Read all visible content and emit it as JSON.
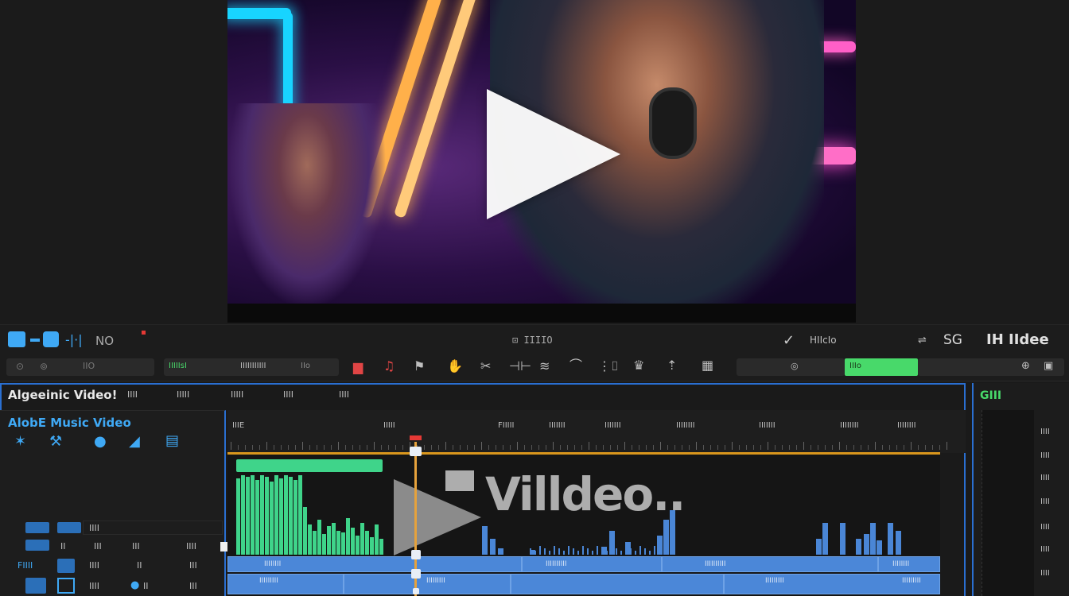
{
  "preview": {
    "play_icon": "play-icon",
    "colors": {
      "neon_cyan": "#1ed2ff",
      "neon_pink": "#ff4fd0",
      "neon_orange": "#ffb347"
    }
  },
  "toolbar_top": {
    "left_label": "NO",
    "center_label": "⊡ IIIIO",
    "right_codes": [
      "V",
      "HIIcIo",
      "SG",
      "IH IIdee"
    ]
  },
  "toolbar_second": {
    "left_items": [
      "⊙",
      "⊚",
      "IIO",
      "IIIIIsI",
      "IIIIIIIIIII",
      "IIo"
    ],
    "status_label": "IIIo"
  },
  "editor": {
    "title": "Algeeinic Video!",
    "tabs": [
      "IIII",
      "IIIII",
      "IIIII",
      "IIII",
      "IIII"
    ],
    "project_name": "AlobE Music Video",
    "left_rows": [
      {
        "label": "IIII",
        "values": [
          "II",
          "III",
          "III",
          "IIII"
        ]
      },
      {
        "label": "FIIII",
        "values": [
          "IIII",
          "II",
          "III"
        ]
      },
      {
        "label": "IIII",
        "values": [
          "IIII",
          "II",
          "III"
        ]
      }
    ],
    "ruler_labels": [
      "IIIE",
      "IIIII",
      "FIIIII",
      "IIIIIII",
      "IIIIIII",
      "IIIIIIII",
      "IIIIIII",
      "IIIIIIII",
      "IIIIIIII"
    ],
    "overlay_text": "Villdeo..",
    "clip_labels": [
      "IIIIIIII",
      "IIIIIIIIII",
      "IIIIIIIIII",
      "IIIIIIII",
      "IIIIIIIII",
      "IIIIIIIII",
      "IIIIIIIII",
      "IIIIIIIII"
    ],
    "right_title": "GIII",
    "right_items": [
      "IIII",
      "IIII",
      "IIII",
      "IIII",
      "IIII",
      "IIII",
      "IIII"
    ]
  },
  "accent": {
    "blue": "#3fa9f5",
    "green": "#48d96a",
    "timeline_blue": "#4b87d8",
    "playhead": "#e6a23c"
  }
}
